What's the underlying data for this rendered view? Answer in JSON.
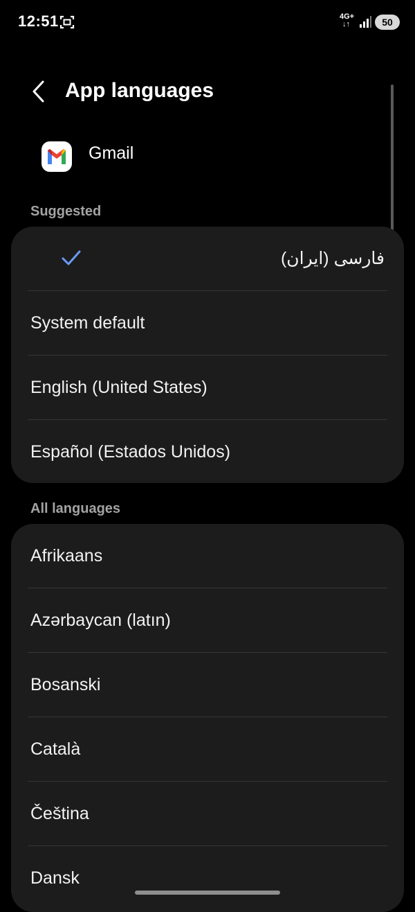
{
  "status_bar": {
    "time": "12:51",
    "network": "4G+",
    "network_arrows": "↓↑",
    "battery": "50",
    "icons": [
      "screenshot-icon",
      "signal-icon",
      "battery-icon"
    ]
  },
  "header": {
    "title": "App languages",
    "back_icon": "chevron-left-icon"
  },
  "app": {
    "name": "Gmail",
    "icon": "gmail-icon"
  },
  "suggested": {
    "header": "Suggested",
    "items": [
      {
        "label": "فارسی (ایران)",
        "selected": true
      },
      {
        "label": "System default",
        "selected": false
      },
      {
        "label": "English (United States)",
        "selected": false
      },
      {
        "label": "Español (Estados Unidos)",
        "selected": false
      }
    ]
  },
  "all_languages": {
    "header": "All languages",
    "items": [
      {
        "label": "Afrikaans"
      },
      {
        "label": "Azərbaycan (latın)"
      },
      {
        "label": "Bosanski"
      },
      {
        "label": "Català"
      },
      {
        "label": "Čeština"
      },
      {
        "label": "Dansk"
      }
    ]
  },
  "colors": {
    "background": "#000000",
    "card": "#1c1c1c",
    "divider": "#363636",
    "check_accent": "#6b9bf5",
    "section_header": "#a3a3a3"
  }
}
